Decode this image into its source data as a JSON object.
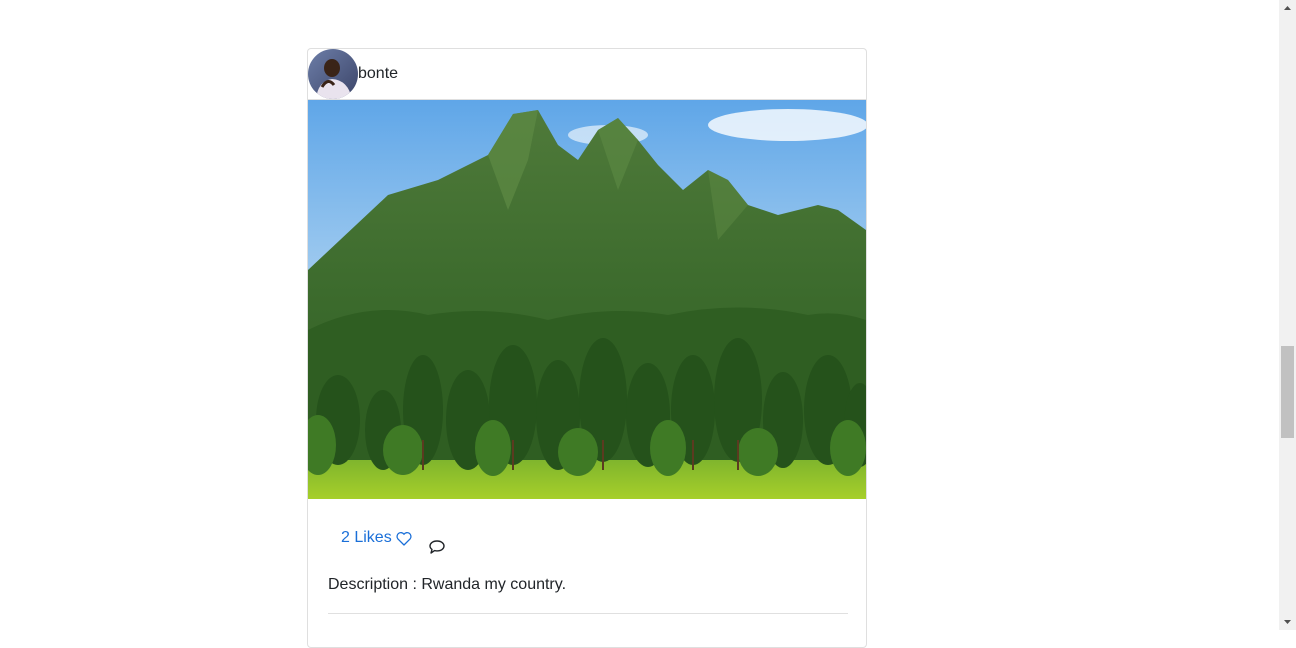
{
  "post": {
    "username": "bonte",
    "likes_label": "2 Likes",
    "description": "Description : Rwanda my country."
  },
  "icons": {
    "like": "heart-outline-icon",
    "comment": "chat-bubble-icon",
    "scroll_up": "arrow-up-icon",
    "scroll_down": "arrow-down-icon"
  },
  "colors": {
    "link": "#1a6fd8",
    "text": "#212529",
    "border": "rgba(0,0,0,0.125)"
  },
  "scrollbar": {
    "position_fraction": 0.55
  }
}
